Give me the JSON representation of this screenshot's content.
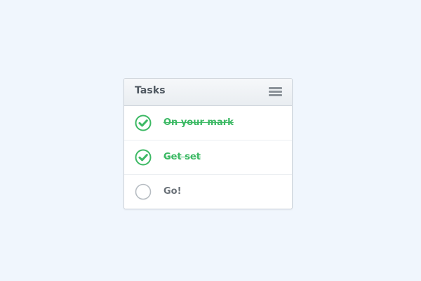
{
  "panel": {
    "title": "Tasks",
    "menu_icon": "hamburger-menu-icon"
  },
  "tasks": [
    {
      "label": "On your mark",
      "completed": true
    },
    {
      "label": "Get set",
      "completed": true
    },
    {
      "label": "Go!",
      "completed": false
    }
  ],
  "colors": {
    "page_background": "#f0f6fd",
    "complete_green": "#3cb964",
    "incomplete_circle": "#b6bcc2",
    "text_gray": "#6a7178",
    "header_text": "#4e5760"
  }
}
